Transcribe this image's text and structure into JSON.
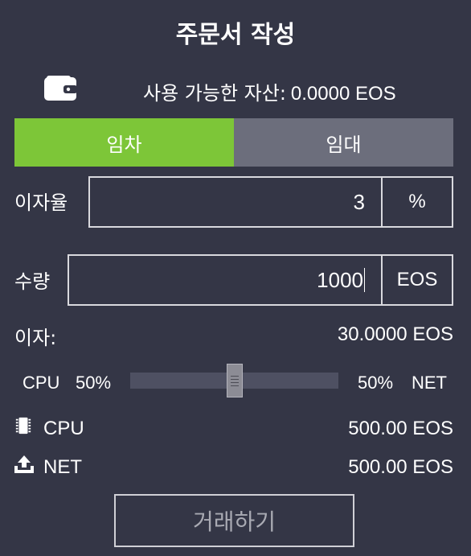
{
  "header": {
    "title": "주문서 작성"
  },
  "asset": {
    "label": "사용 가능한 자산:",
    "value": "0.0000 EOS"
  },
  "tabs": [
    {
      "label": "임차",
      "active": true
    },
    {
      "label": "임대",
      "active": false
    }
  ],
  "interest_rate": {
    "label": "이자율",
    "value": "3",
    "unit": "%"
  },
  "quantity": {
    "label": "수량",
    "value": "1000",
    "unit": "EOS"
  },
  "interest": {
    "label": "이자:",
    "value": "30.0000 EOS"
  },
  "split_slider": {
    "left_label": "CPU",
    "left_percent": "50%",
    "right_percent": "50%",
    "right_label": "NET",
    "value": 0.5
  },
  "allocations": [
    {
      "icon": "chip-icon",
      "label": "CPU",
      "value": "500.00 EOS"
    },
    {
      "icon": "upload-icon",
      "label": "NET",
      "value": "500.00 EOS"
    }
  ],
  "submit": {
    "label": "거래하기"
  },
  "colors": {
    "background": "#343646",
    "active_tab": "#7dc638",
    "inactive_tab": "#6c6e7c",
    "slider_track": "#4e5062"
  }
}
